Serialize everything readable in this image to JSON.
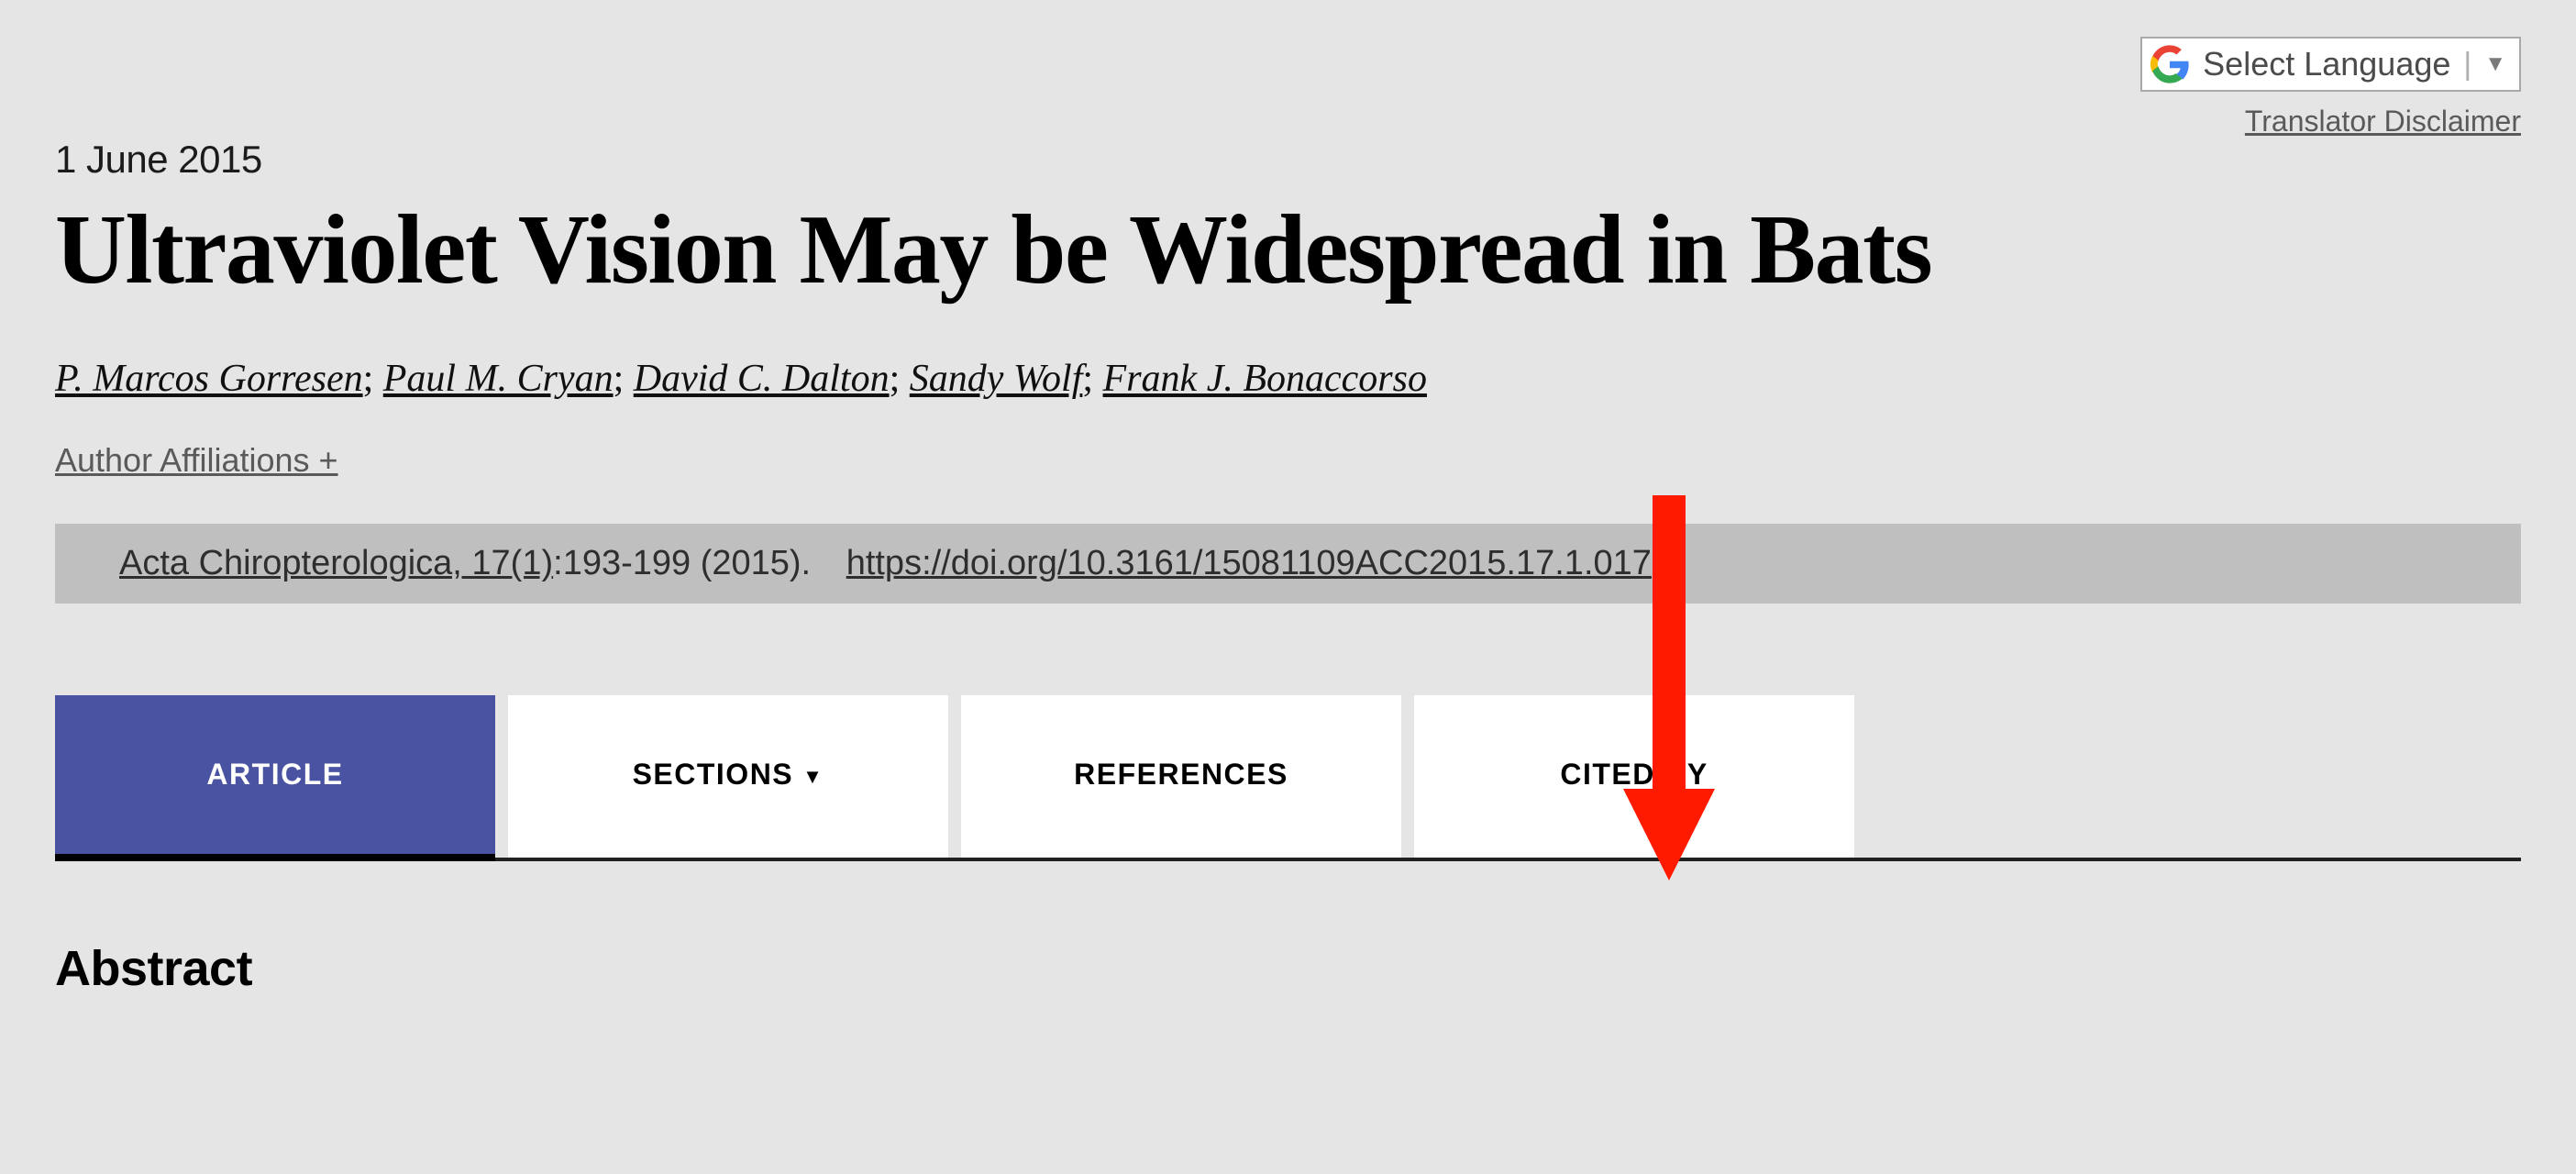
{
  "language_selector": {
    "label": "Select Language"
  },
  "translator_disclaimer": "Translator Disclaimer",
  "date": "1 June 2015",
  "title": "Ultraviolet Vision May be Widespread in Bats",
  "authors": [
    "P. Marcos Gorresen",
    "Paul M. Cryan",
    "David C. Dalton",
    "Sandy Wolf",
    "Frank J. Bonaccorso"
  ],
  "affiliations_label": "Author Affiliations +",
  "citation": {
    "journal": "Acta Chiropterologica, 17(1)",
    "pages": ":193-199 (2015).",
    "doi": "https://doi.org/10.3161/15081109ACC2015.17.1.017"
  },
  "tabs": {
    "article": "ARTICLE",
    "sections": "SECTIONS",
    "references": "REFERENCES",
    "cited_by": "CITED BY"
  },
  "abstract_heading": "Abstract"
}
